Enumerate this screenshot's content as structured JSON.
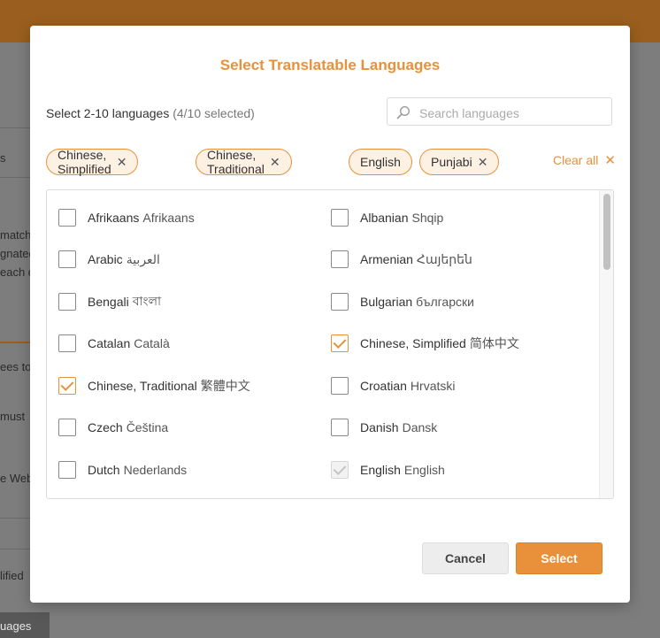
{
  "background": {
    "fragments": [
      "match",
      "gnated",
      "each d",
      "ees to",
      "must",
      "e Web",
      "lified",
      "uages",
      "s"
    ]
  },
  "modal": {
    "title": "Select Translatable Languages",
    "subtitle_prefix": "Select 2-10 languages",
    "selected_count": "(4/10 selected)",
    "search_placeholder": "Search languages",
    "search_value": "",
    "clear_all_label": "Clear all",
    "chips": [
      "Chinese, Simplified",
      "Chinese, Traditional",
      "English",
      "Punjabi"
    ],
    "languages": [
      {
        "name": "Afrikaans",
        "native": "Afrikaans",
        "state": "unchecked"
      },
      {
        "name": "Albanian",
        "native": "Shqip",
        "state": "unchecked"
      },
      {
        "name": "Arabic",
        "native": "العربية",
        "state": "unchecked"
      },
      {
        "name": "Armenian",
        "native": "Հայերեն",
        "state": "unchecked"
      },
      {
        "name": "Bengali",
        "native": "বাংলা",
        "state": "unchecked"
      },
      {
        "name": "Bulgarian",
        "native": "български",
        "state": "unchecked"
      },
      {
        "name": "Catalan",
        "native": "Català",
        "state": "unchecked"
      },
      {
        "name": "Chinese, Simplified",
        "native": "简体中文",
        "state": "checked"
      },
      {
        "name": "Chinese, Traditional",
        "native": "繁體中文",
        "state": "checked"
      },
      {
        "name": "Croatian",
        "native": "Hrvatski",
        "state": "unchecked"
      },
      {
        "name": "Czech",
        "native": "Čeština",
        "state": "unchecked"
      },
      {
        "name": "Danish",
        "native": "Dansk",
        "state": "unchecked"
      },
      {
        "name": "Dutch",
        "native": "Nederlands",
        "state": "unchecked"
      },
      {
        "name": "English",
        "native": "English",
        "state": "checked-disabled"
      }
    ],
    "cancel_label": "Cancel",
    "select_label": "Select"
  },
  "colors": {
    "accent": "#e8913a",
    "chip_background": "#fdf1e4",
    "overlay_header": "#9a5f1e"
  }
}
